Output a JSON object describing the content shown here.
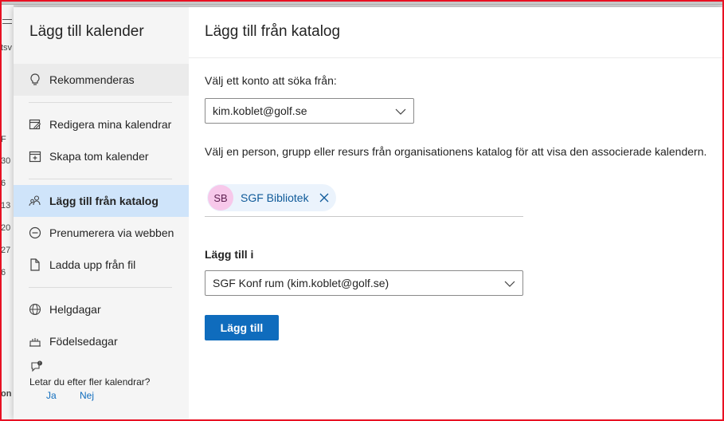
{
  "background": {
    "strip_text": [
      "tsv",
      "F",
      "30",
      "6",
      "13",
      "20",
      "27",
      "6",
      "on"
    ]
  },
  "sidebar": {
    "title": "Lägg till kalender",
    "items": [
      {
        "label": "Rekommenderas",
        "icon": "lightbulb-icon"
      },
      {
        "label": "Redigera mina kalendrar",
        "icon": "edit-calendar-icon"
      },
      {
        "label": "Skapa tom kalender",
        "icon": "add-calendar-icon"
      },
      {
        "label": "Lägg till från katalog",
        "icon": "people-directory-icon"
      },
      {
        "label": "Prenumerera via webben",
        "icon": "link-icon"
      },
      {
        "label": "Ladda upp från fil",
        "icon": "file-upload-icon"
      },
      {
        "label": "Helgdagar",
        "icon": "globe-icon"
      },
      {
        "label": "Födelsedagar",
        "icon": "birthday-cake-icon"
      }
    ],
    "more_prompt": "Letar du efter fler kalendrar?",
    "yes_label": "Ja",
    "no_label": "Nej"
  },
  "main": {
    "title": "Lägg till från katalog",
    "account_label": "Välj ett konto att söka från:",
    "account_value": "kim.koblet@golf.se",
    "description": "Välj en person, grupp eller resurs från organisationens katalog för att visa den associerade kalendern.",
    "chip": {
      "initials": "SB",
      "name": "SGF Bibliotek"
    },
    "add_to_label": "Lägg till i",
    "add_to_value": "SGF Konf rum (kim.koblet@golf.se)",
    "add_button": "Lägg till"
  },
  "colors": {
    "accent": "#0f6cbd",
    "active_nav": "#cfe4fa",
    "frame": "#e81123",
    "avatar_bg": "#f7c8ea"
  }
}
